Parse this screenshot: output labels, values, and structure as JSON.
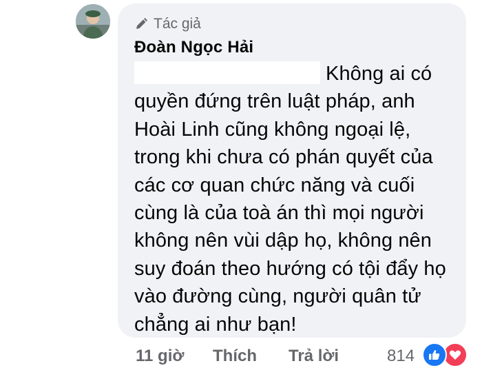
{
  "comment": {
    "badge_label": "Tác giả",
    "author_name": "Đoàn Ngọc Hải",
    "text": "Không ai có quyền đứng trên luật pháp, anh Hoài Linh cũng không ngoại lệ, trong khi chưa có phán quyết của các cơ quan chức năng và cuối cùng là của toà án thì mọi người không nên vùi dập họ, không nên suy đoán theo hướng có tội đẩy họ vào đường cùng, người quân tử chẳng ai như bạn!"
  },
  "actions": {
    "time": "11 giờ",
    "like_label": "Thích",
    "reply_label": "Trả lời",
    "reaction_count": "814"
  },
  "icons": {
    "badge": "pen-icon",
    "reactions": [
      "like-reaction-icon",
      "love-reaction-icon"
    ]
  },
  "colors": {
    "bubble_bg": "#f0f2f5",
    "secondary_text": "#65676b",
    "like_blue": "#1877f2",
    "love_red": "#f33e58"
  }
}
